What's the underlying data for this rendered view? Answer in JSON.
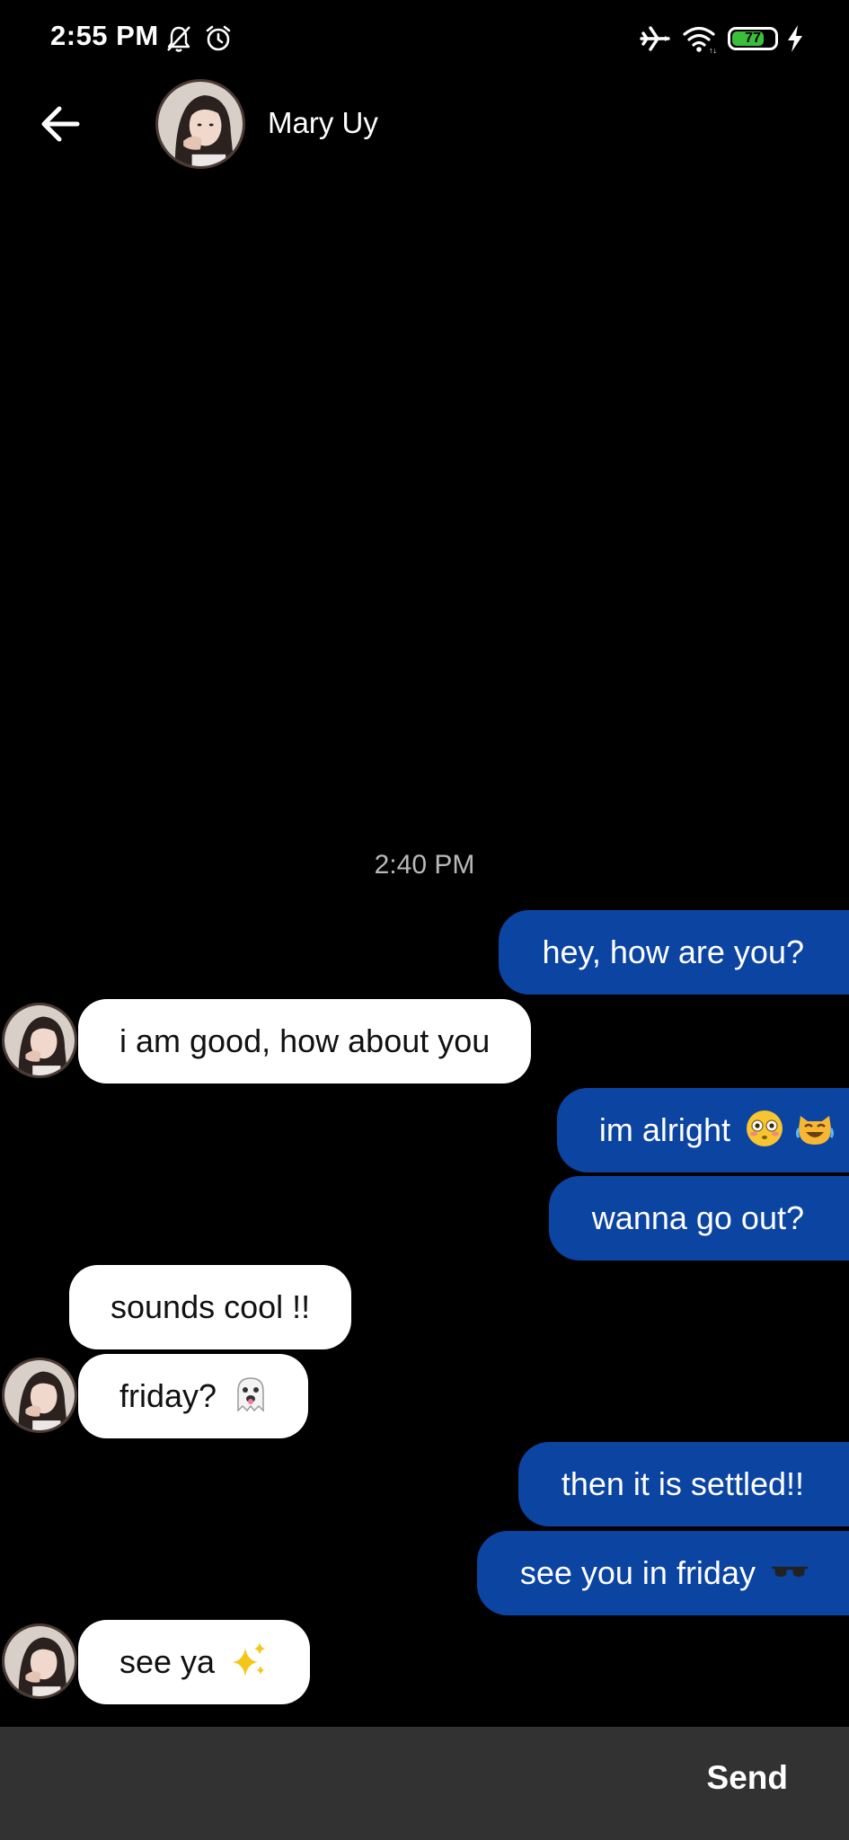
{
  "status_bar": {
    "time": "2:55 PM",
    "battery_level": "77",
    "battery_fraction": 0.77,
    "icons": [
      "bell-off-icon",
      "alarm-icon",
      "airplane-icon",
      "wifi-icon",
      "battery-icon",
      "charging-icon"
    ]
  },
  "header": {
    "back_icon": "arrow-left-icon",
    "contact_name": "Mary Uy"
  },
  "conversation": {
    "timestamp": "2:40 PM",
    "messages": [
      {
        "sender": "me",
        "text": "hey, how are you?"
      },
      {
        "sender": "them",
        "text": "i am good, how about you"
      },
      {
        "sender": "me",
        "text": "im alright",
        "emoji": [
          "flushed-face-emoji",
          "cat-tears-of-joy-emoji"
        ]
      },
      {
        "sender": "me",
        "text": "wanna go out?"
      },
      {
        "sender": "them",
        "text": "sounds cool !!"
      },
      {
        "sender": "them",
        "text": "friday?",
        "emoji": [
          "ghost-emoji"
        ]
      },
      {
        "sender": "me",
        "text": "then it is settled!!"
      },
      {
        "sender": "me",
        "text": "see you in friday",
        "emoji": [
          "sunglasses-emoji"
        ]
      },
      {
        "sender": "them",
        "text": "see ya",
        "emoji": [
          "sparkles-emoji"
        ]
      }
    ]
  },
  "composer": {
    "input_value": "",
    "send_label": "Send"
  },
  "colors": {
    "background": "#000000",
    "outgoing_bubble": "#0c44a2",
    "incoming_bubble": "#ffffff",
    "composer_bar": "#323232",
    "battery_fill": "#3bbf3b"
  }
}
